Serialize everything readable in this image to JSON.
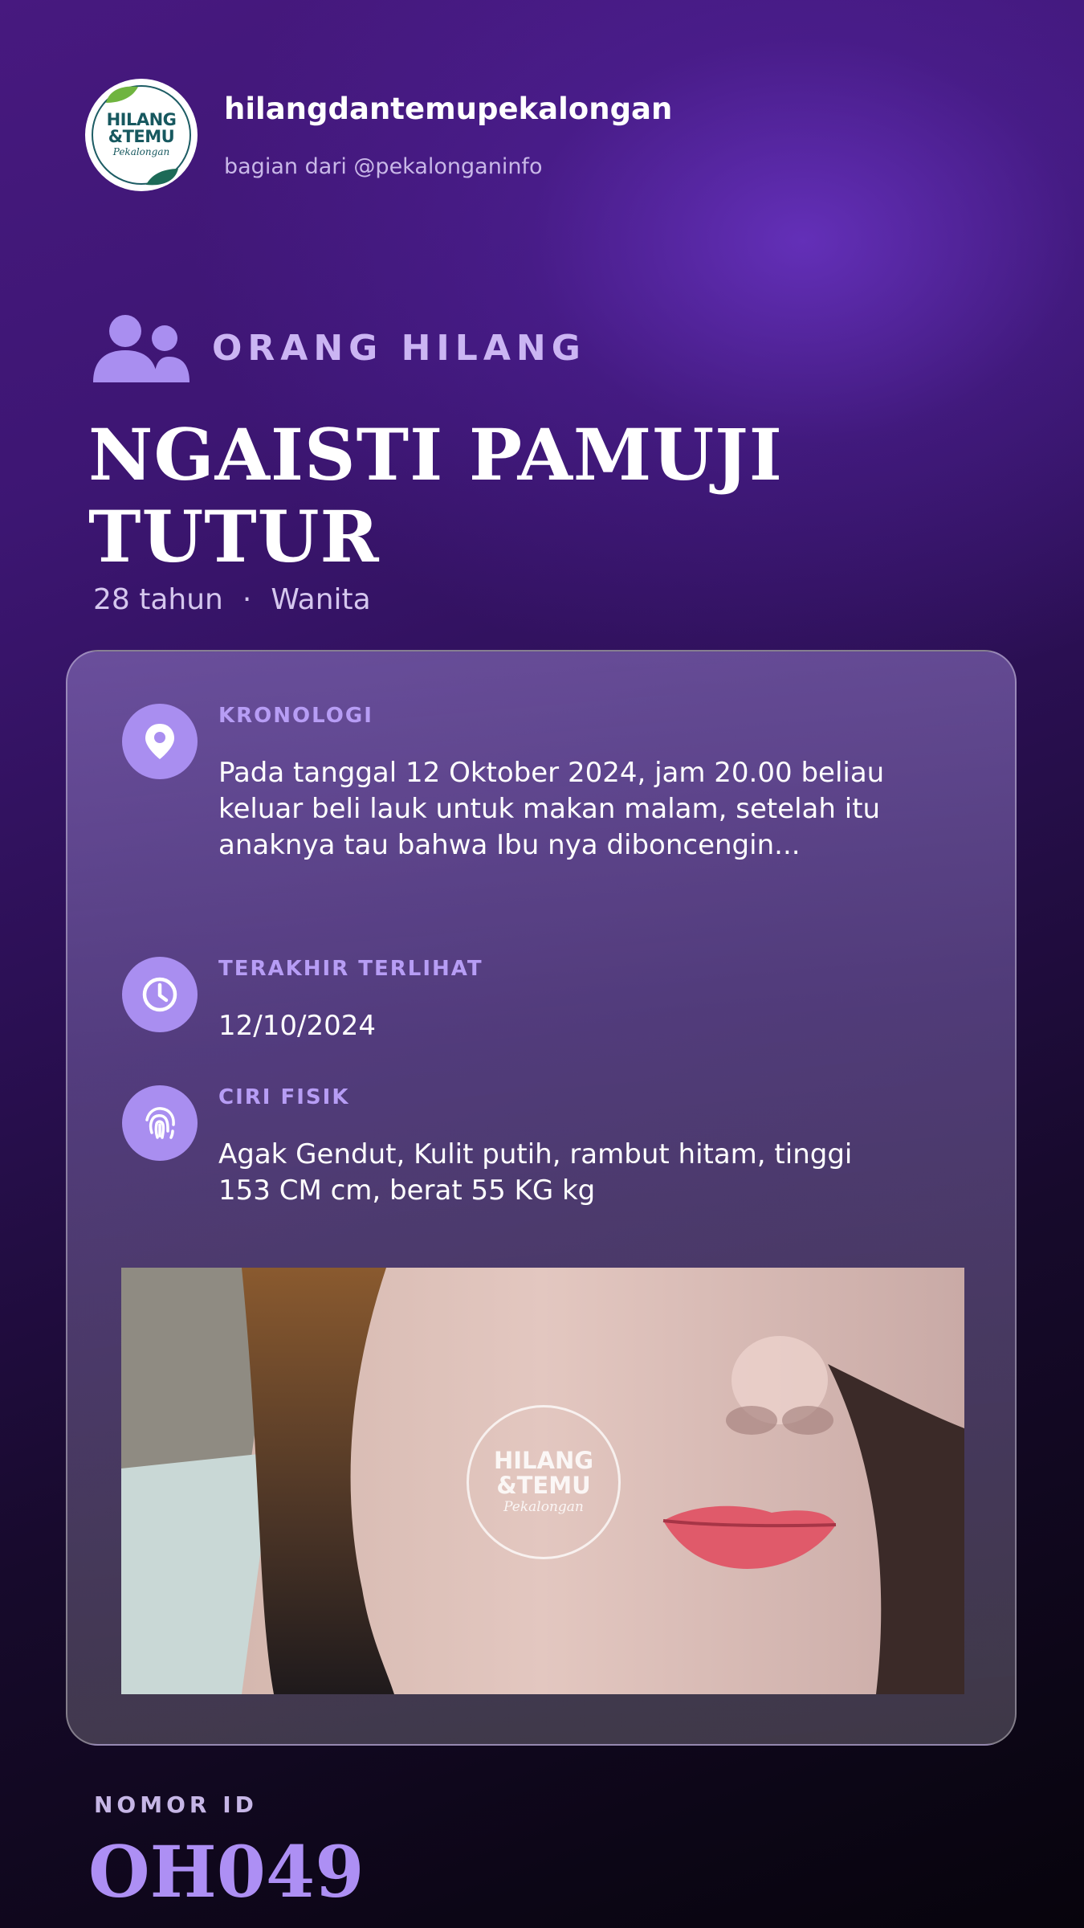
{
  "header": {
    "logo": {
      "line1": "HILANG",
      "line2": "&TEMU",
      "line3": "Pekalongan",
      "icon": "hilang-temu-logo"
    },
    "account_name": "hilangdantemupekalongan",
    "account_sub": "bagian dari @pekalonganinfo"
  },
  "category": {
    "icon": "people-icon",
    "label": "ORANG HILANG"
  },
  "person": {
    "name": "NGAISTI PAMUJI TUTUR",
    "age": "28 tahun",
    "separator": "·",
    "gender": "Wanita"
  },
  "details": {
    "kronologi": {
      "icon": "location-pin-icon",
      "label": "KRONOLOGI",
      "value": "Pada tanggal 12 Oktober 2024, jam 20.00 beliau keluar beli lauk untuk makan malam, setelah itu anaknya tau bahwa Ibu nya diboncengin..."
    },
    "terakhir_terlihat": {
      "icon": "clock-icon",
      "label": "TERAKHIR TERLIHAT",
      "value": "12/10/2024"
    },
    "ciri_fisik": {
      "icon": "fingerprint-icon",
      "label": "CIRI FISIK",
      "value": "Agak Gendut, Kulit putih, rambut hitam, tinggi 153 CM cm, berat 55 KG kg"
    }
  },
  "photo": {
    "watermark": {
      "line1": "HILANG",
      "line2": "&TEMU",
      "line3": "Pekalongan"
    }
  },
  "footer": {
    "id_label": "NOMOR ID",
    "id_value": "OH049"
  },
  "colors": {
    "accent": "#a98ef0",
    "label": "#b79df5",
    "id": "#ad8ff4",
    "logo_green": "#17585f"
  }
}
